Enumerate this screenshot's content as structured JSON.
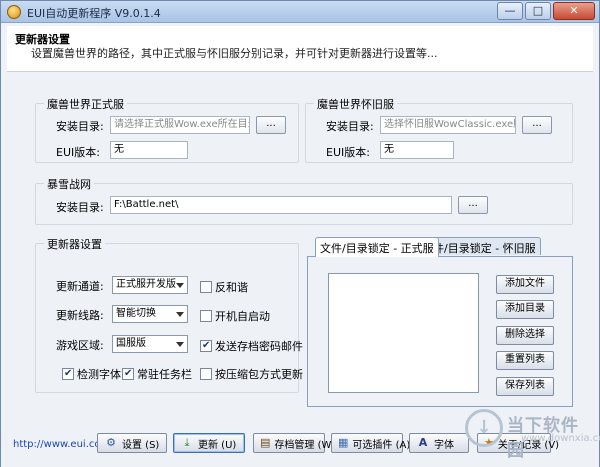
{
  "window": {
    "title": "EUI自动更新程序 V9.0.1.4",
    "controls": {
      "minimize": "—",
      "maximize": "□",
      "close": "✕"
    }
  },
  "header": {
    "title": "更新器设置",
    "description": "设置魔兽世界的路径，其中正式服与怀旧服分别记录，并可针对更新器进行设置等..."
  },
  "retail": {
    "title": "魔兽世界正式服",
    "install_label": "安装目录:",
    "install_placeholder": "请选择正式服Wow.exe所在目录",
    "browse": "...",
    "version_label": "EUI版本:",
    "version_value": "无"
  },
  "classic": {
    "title": "魔兽世界怀旧服",
    "install_label": "安装目录:",
    "install_placeholder": "选择怀旧服WowClassic.exe所在目录",
    "browse": "...",
    "version_label": "EUI版本:",
    "version_value": "无"
  },
  "battlenet": {
    "title": "暴雪战网",
    "install_label": "安装目录:",
    "install_value": "F:\\Battle.net\\",
    "browse": "..."
  },
  "updater": {
    "title": "更新器设置",
    "channel_label": "更新通道:",
    "channel_value": "正式服开发版",
    "route_label": "更新线路:",
    "route_value": "智能切换",
    "region_label": "游戏区域:",
    "region_value": "国服版",
    "checkboxes": {
      "anti_harmony": {
        "label": "反和谐",
        "checked": false
      },
      "autostart": {
        "label": "开机自启动",
        "checked": false
      },
      "send_email": {
        "label": "发送存档密码邮件",
        "checked": true
      },
      "detect_font": {
        "label": "检测字体",
        "checked": true
      },
      "tray": {
        "label": "常驻任务栏",
        "checked": true
      },
      "compress": {
        "label": "按压缩包方式更新",
        "checked": false
      }
    }
  },
  "lock": {
    "tabs": [
      "文件/目录锁定 - 正式服",
      "文件/目录锁定 - 怀旧服"
    ],
    "buttons": {
      "add_file": "添加文件",
      "add_dir": "添加目录",
      "delete": "删除选择",
      "reset": "重置列表",
      "save": "保存列表"
    }
  },
  "footer": {
    "link": "http://www.eui.cc",
    "buttons": {
      "settings": "设置 (S)",
      "update": "更新 (U)",
      "archive": "存档管理 (W)",
      "plugins": "可选插件 (A)",
      "font": "字体",
      "about": "关于/记录 (V)"
    }
  },
  "watermark": {
    "text": "当下软件园",
    "url": "www.downxia.com"
  }
}
